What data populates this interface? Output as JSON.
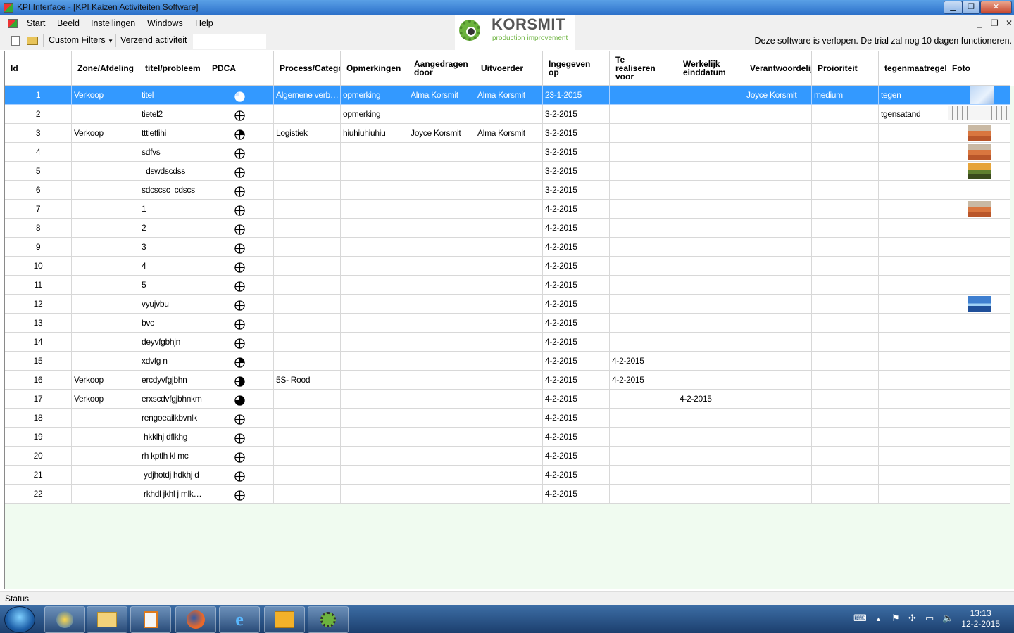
{
  "window": {
    "title": "KPI Interface - [KPI Kaizen Activiteiten Software]",
    "controls": {
      "minimize": "▁",
      "maximize": "❐",
      "close": "✕"
    }
  },
  "menu": {
    "items": [
      "Start",
      "Beeld",
      "Instellingen",
      "Windows",
      "Help"
    ],
    "mdi_controls": {
      "minimize": "_",
      "restore": "❐",
      "close": "✕"
    }
  },
  "toolbar": {
    "custom_filters": "Custom Filters",
    "verzend": "Verzend activiteit",
    "trial_message": "Deze software is verlopen. De trial zal nog 10 dagen functioneren."
  },
  "logo": {
    "brand": "KORSMIT",
    "tagline": "production improvement"
  },
  "table": {
    "columns": [
      "Id",
      "Zone/Afdeling",
      "titel/probleem",
      "PDCA",
      "Process/Categorie",
      "Opmerkingen",
      "Aangedragen\ndoor",
      "Uitvoerder",
      "Ingegeven\nop",
      "Te\nrealiseren\nvoor",
      "Werkelijk\neinddatum",
      "Verantwoordelijke",
      "Proioriteit",
      "tegenmaatregel",
      "Foto"
    ],
    "rows": [
      {
        "id": "1",
        "zone": "Verkoop",
        "titel": "titel",
        "pdca": "p1",
        "process": "Algemene verbeteringen",
        "opm": "opmerking",
        "aangedragen": "Alma Korsmit",
        "uitvoerder": "Alma Korsmit",
        "ingegeven": "23-1-2015",
        "te_real": "",
        "werkelijk": "",
        "verantw": "Joyce Korsmit",
        "prio": "medium",
        "tegen": "tegen",
        "foto": "sky"
      },
      {
        "id": "2",
        "zone": "",
        "titel": "tietel2",
        "pdca": "p0",
        "process": "",
        "opm": "opmerking",
        "aangedragen": "",
        "uitvoerder": "",
        "ingegeven": "3-2-2015",
        "te_real": "",
        "werkelijk": "",
        "verantw": "",
        "prio": "",
        "tegen": "tgensatand",
        "foto": "doc"
      },
      {
        "id": "3",
        "zone": "Verkoop",
        "titel": "tttietfihi",
        "pdca": "p2",
        "process": "Logistiek",
        "opm": "hiuhiuhiuhiu",
        "aangedragen": "Joyce Korsmit",
        "uitvoerder": "Alma Korsmit",
        "ingegeven": "3-2-2015",
        "te_real": "",
        "werkelijk": "",
        "verantw": "",
        "prio": "",
        "tegen": "",
        "foto": "desert"
      },
      {
        "id": "4",
        "zone": "",
        "titel": "sdfvs",
        "pdca": "p0",
        "process": "",
        "opm": "",
        "aangedragen": "",
        "uitvoerder": "",
        "ingegeven": "3-2-2015",
        "te_real": "",
        "werkelijk": "",
        "verantw": "",
        "prio": "",
        "tegen": "",
        "foto": "desert"
      },
      {
        "id": "5",
        "zone": "",
        "titel": "  dswdscdss",
        "pdca": "p0",
        "process": "",
        "opm": "",
        "aangedragen": "",
        "uitvoerder": "",
        "ingegeven": "3-2-2015",
        "te_real": "",
        "werkelijk": "",
        "verantw": "",
        "prio": "",
        "tegen": "",
        "foto": "autumn"
      },
      {
        "id": "6",
        "zone": "",
        "titel": "sdcscsc  cdscs",
        "pdca": "p0",
        "process": "",
        "opm": "",
        "aangedragen": "",
        "uitvoerder": "",
        "ingegeven": "3-2-2015",
        "te_real": "",
        "werkelijk": "",
        "verantw": "",
        "prio": "",
        "tegen": "",
        "foto": ""
      },
      {
        "id": "7",
        "zone": "",
        "titel": "1",
        "pdca": "p0",
        "process": "",
        "opm": "",
        "aangedragen": "",
        "uitvoerder": "",
        "ingegeven": "4-2-2015",
        "te_real": "",
        "werkelijk": "",
        "verantw": "",
        "prio": "",
        "tegen": "",
        "foto": "desert"
      },
      {
        "id": "8",
        "zone": "",
        "titel": "2",
        "pdca": "p0",
        "process": "",
        "opm": "",
        "aangedragen": "",
        "uitvoerder": "",
        "ingegeven": "4-2-2015",
        "te_real": "",
        "werkelijk": "",
        "verantw": "",
        "prio": "",
        "tegen": "",
        "foto": ""
      },
      {
        "id": "9",
        "zone": "",
        "titel": "3",
        "pdca": "p0",
        "process": "",
        "opm": "",
        "aangedragen": "",
        "uitvoerder": "",
        "ingegeven": "4-2-2015",
        "te_real": "",
        "werkelijk": "",
        "verantw": "",
        "prio": "",
        "tegen": "",
        "foto": ""
      },
      {
        "id": "10",
        "zone": "",
        "titel": "4",
        "pdca": "p0",
        "process": "",
        "opm": "",
        "aangedragen": "",
        "uitvoerder": "",
        "ingegeven": "4-2-2015",
        "te_real": "",
        "werkelijk": "",
        "verantw": "",
        "prio": "",
        "tegen": "",
        "foto": ""
      },
      {
        "id": "11",
        "zone": "",
        "titel": "5",
        "pdca": "p0",
        "process": "",
        "opm": "",
        "aangedragen": "",
        "uitvoerder": "",
        "ingegeven": "4-2-2015",
        "te_real": "",
        "werkelijk": "",
        "verantw": "",
        "prio": "",
        "tegen": "",
        "foto": ""
      },
      {
        "id": "12",
        "zone": "",
        "titel": "vyujvbu",
        "pdca": "p0",
        "process": "",
        "opm": "",
        "aangedragen": "",
        "uitvoerder": "",
        "ingegeven": "4-2-2015",
        "te_real": "",
        "werkelijk": "",
        "verantw": "",
        "prio": "",
        "tegen": "",
        "foto": "ice"
      },
      {
        "id": "13",
        "zone": "",
        "titel": "bvc",
        "pdca": "p0",
        "process": "",
        "opm": "",
        "aangedragen": "",
        "uitvoerder": "",
        "ingegeven": "4-2-2015",
        "te_real": "",
        "werkelijk": "",
        "verantw": "",
        "prio": "",
        "tegen": "",
        "foto": ""
      },
      {
        "id": "14",
        "zone": "",
        "titel": "deyvfgbhjn",
        "pdca": "p0",
        "process": "",
        "opm": "",
        "aangedragen": "",
        "uitvoerder": "",
        "ingegeven": "4-2-2015",
        "te_real": "",
        "werkelijk": "",
        "verantw": "",
        "prio": "",
        "tegen": "",
        "foto": ""
      },
      {
        "id": "15",
        "zone": "",
        "titel": "xdvfg n",
        "pdca": "p2",
        "process": "",
        "opm": "",
        "aangedragen": "",
        "uitvoerder": "",
        "ingegeven": "4-2-2015",
        "te_real": "4-2-2015",
        "werkelijk": "",
        "verantw": "",
        "prio": "",
        "tegen": "",
        "foto": ""
      },
      {
        "id": "16",
        "zone": "Verkoop",
        "titel": "ercdyvfgjbhn",
        "pdca": "p3",
        "process": "5S- Rood",
        "opm": "",
        "aangedragen": "",
        "uitvoerder": "",
        "ingegeven": "4-2-2015",
        "te_real": "4-2-2015",
        "werkelijk": "",
        "verantw": "",
        "prio": "",
        "tegen": "",
        "foto": ""
      },
      {
        "id": "17",
        "zone": "Verkoop",
        "titel": "erxscdvfgjbhnkm",
        "pdca": "p4",
        "process": "",
        "opm": "",
        "aangedragen": "",
        "uitvoerder": "",
        "ingegeven": "4-2-2015",
        "te_real": "",
        "werkelijk": "4-2-2015",
        "verantw": "",
        "prio": "",
        "tegen": "",
        "foto": ""
      },
      {
        "id": "18",
        "zone": "",
        "titel": "rengoeailkbvnlk",
        "pdca": "p0",
        "process": "",
        "opm": "",
        "aangedragen": "",
        "uitvoerder": "",
        "ingegeven": "4-2-2015",
        "te_real": "",
        "werkelijk": "",
        "verantw": "",
        "prio": "",
        "tegen": "",
        "foto": ""
      },
      {
        "id": "19",
        "zone": "",
        "titel": " hkklhj dflkhg",
        "pdca": "p0",
        "process": "",
        "opm": "",
        "aangedragen": "",
        "uitvoerder": "",
        "ingegeven": "4-2-2015",
        "te_real": "",
        "werkelijk": "",
        "verantw": "",
        "prio": "",
        "tegen": "",
        "foto": ""
      },
      {
        "id": "20",
        "zone": "",
        "titel": "rh kptlh kl mc",
        "pdca": "p0",
        "process": "",
        "opm": "",
        "aangedragen": "",
        "uitvoerder": "",
        "ingegeven": "4-2-2015",
        "te_real": "",
        "werkelijk": "",
        "verantw": "",
        "prio": "",
        "tegen": "",
        "foto": ""
      },
      {
        "id": "21",
        "zone": "",
        "titel": " ydjhotdj hdkhj d",
        "pdca": "p0",
        "process": "",
        "opm": "",
        "aangedragen": "",
        "uitvoerder": "",
        "ingegeven": "4-2-2015",
        "te_real": "",
        "werkelijk": "",
        "verantw": "",
        "prio": "",
        "tegen": "",
        "foto": ""
      },
      {
        "id": "22",
        "zone": "",
        "titel": " rkhdl jkhl j mlkm lkjhkj",
        "pdca": "p0",
        "process": "",
        "opm": "",
        "aangedragen": "",
        "uitvoerder": "",
        "ingegeven": "4-2-2015",
        "te_real": "",
        "werkelijk": "",
        "verantw": "",
        "prio": "",
        "tegen": "",
        "foto": ""
      }
    ],
    "selected_row_color": "#3399ff"
  },
  "status": {
    "text": "Status"
  },
  "taskbar": {
    "apps": [
      "start-orb",
      "media-center-icon",
      "file-explorer-icon",
      "media-player-icon",
      "firefox-icon",
      "internet-explorer-icon",
      "outlook-icon",
      "korsmit-app-icon"
    ],
    "time": "13:13",
    "date": "12-2-2015"
  }
}
